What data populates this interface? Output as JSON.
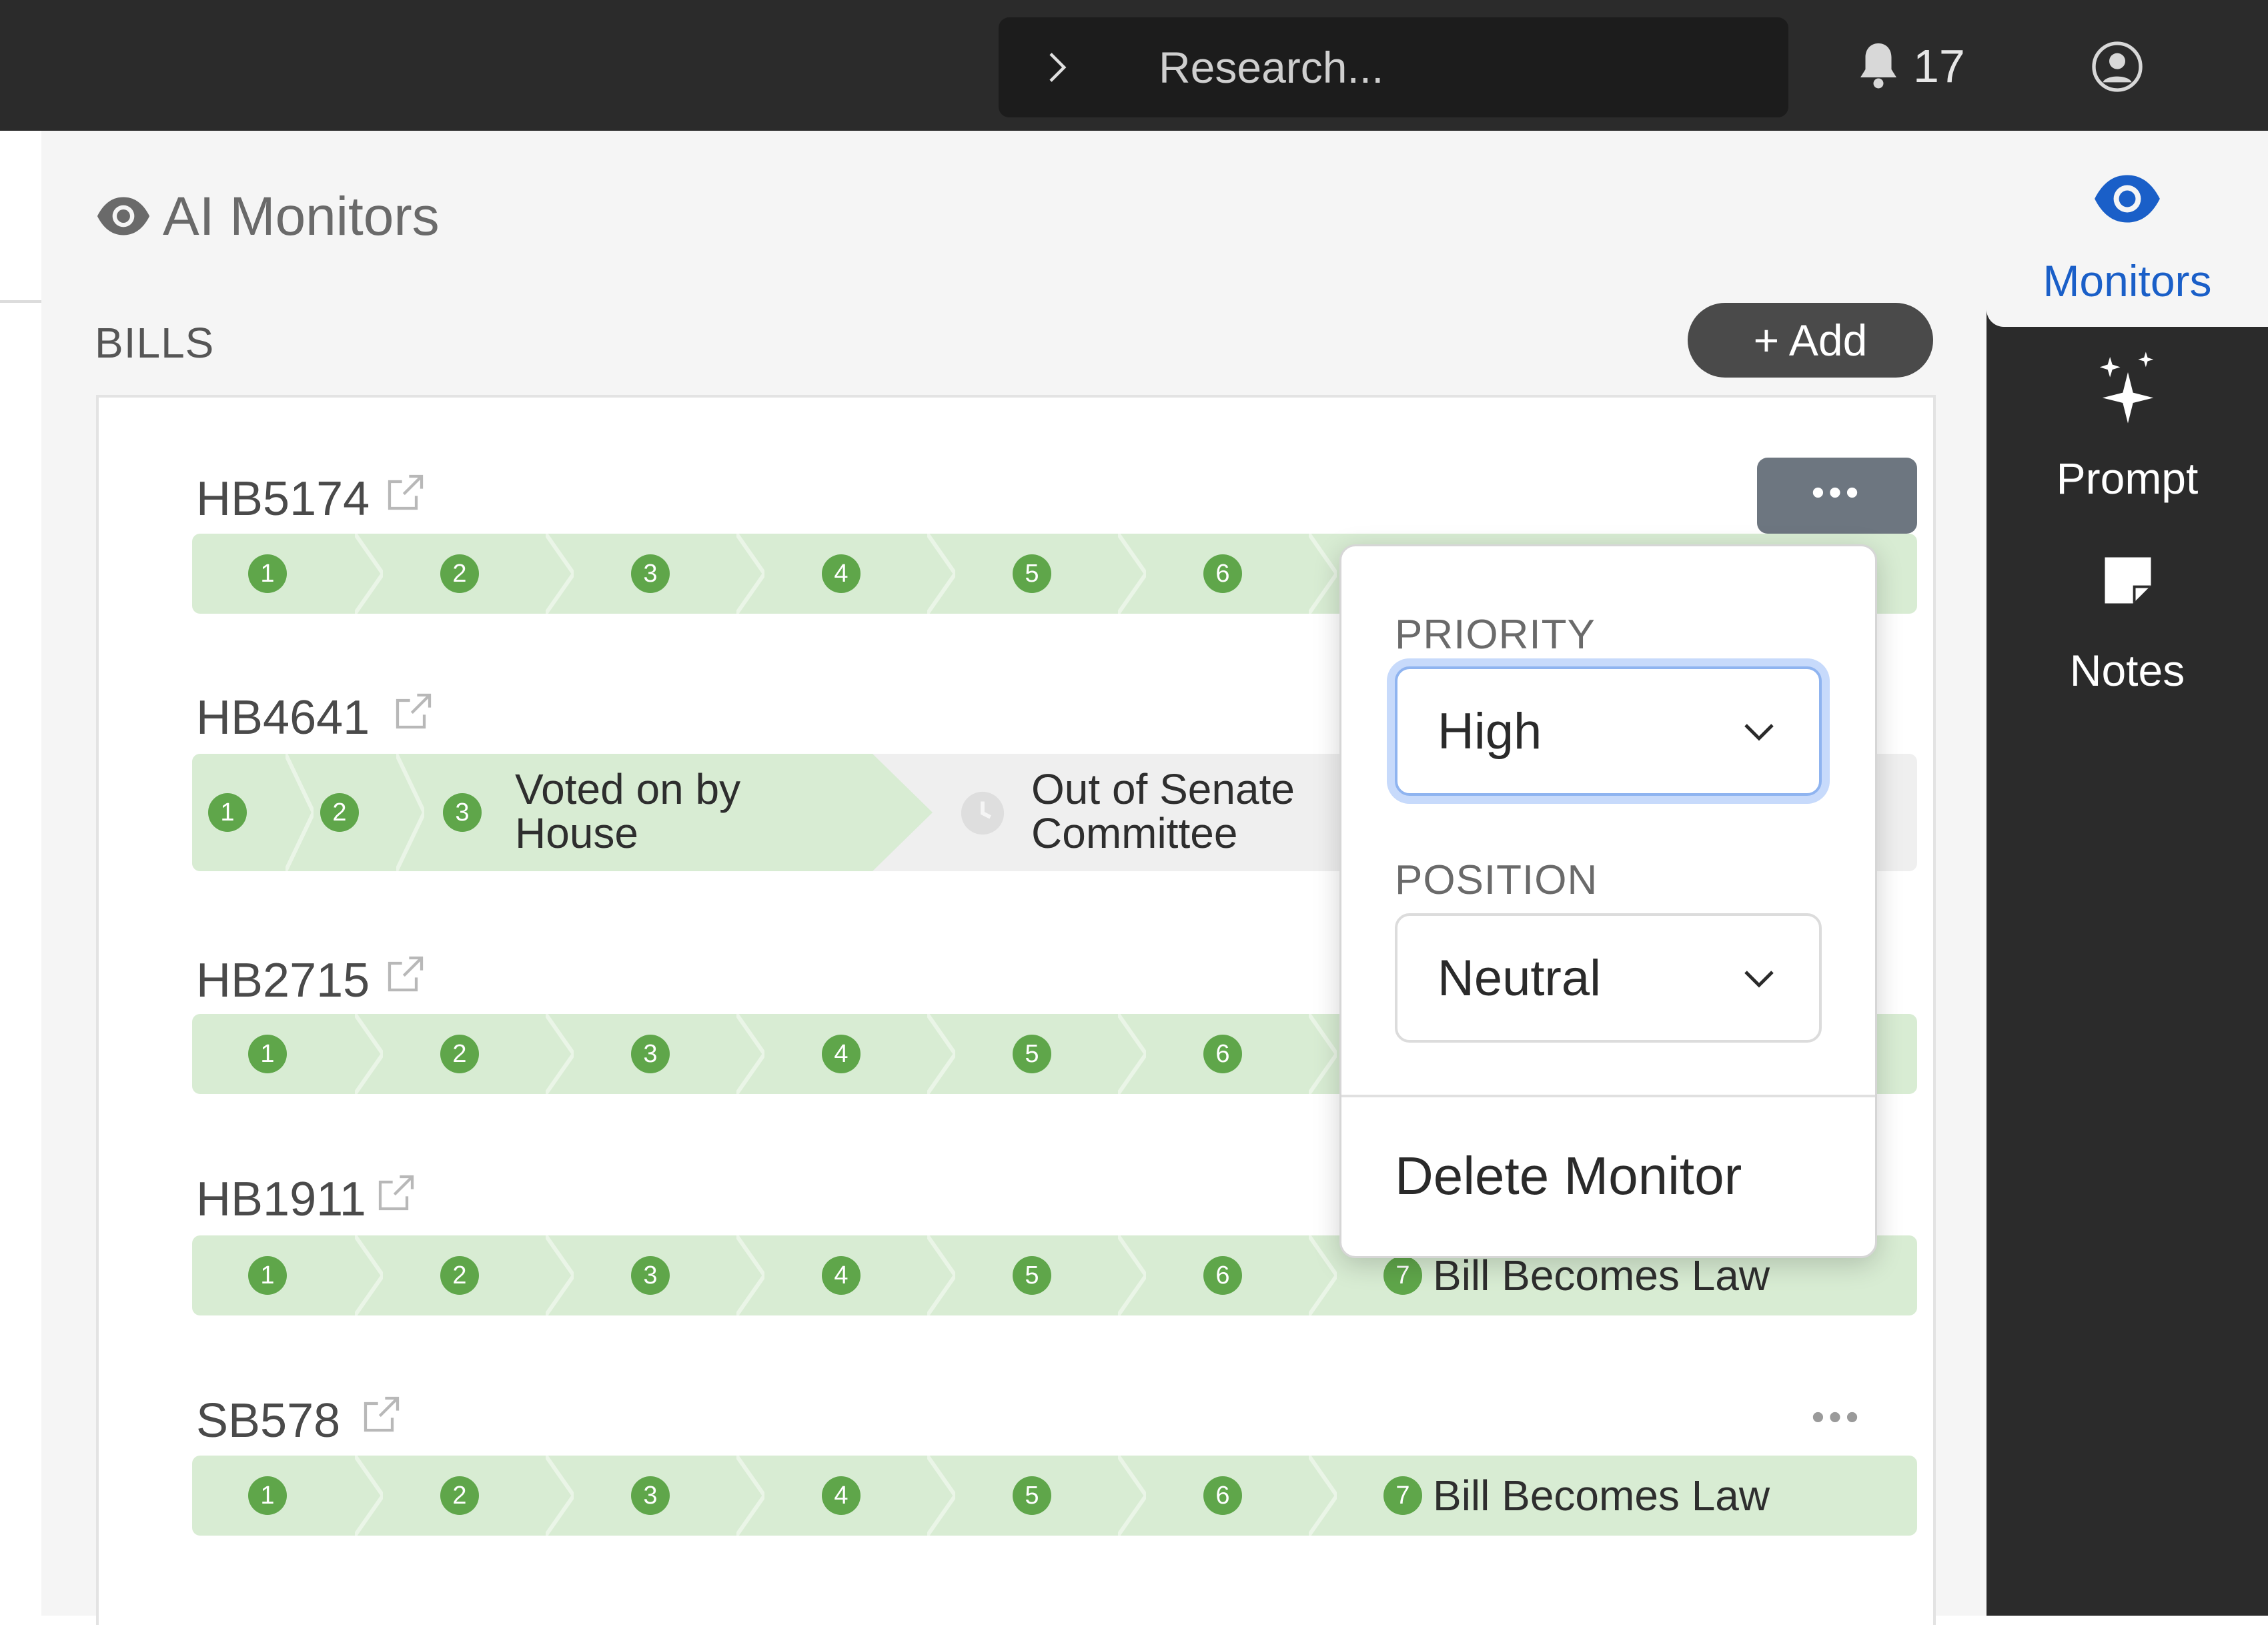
{
  "topbar": {
    "search_placeholder": "Research...",
    "notification_count": "17"
  },
  "page": {
    "title": "AI Monitors",
    "section_label": "BILLS",
    "add_button": "+ Add"
  },
  "bills": [
    {
      "id": "HB5174",
      "steps": [
        "1",
        "2",
        "3",
        "4",
        "5",
        "6"
      ]
    },
    {
      "id": "HB4641",
      "steps": [
        "1",
        "2",
        "3"
      ],
      "current_stage": "Voted on by House",
      "next_stage": "Out of Senate Committee"
    },
    {
      "id": "HB2715",
      "steps": [
        "1",
        "2",
        "3",
        "4",
        "5",
        "6"
      ]
    },
    {
      "id": "HB1911",
      "steps": [
        "1",
        "2",
        "3",
        "4",
        "5",
        "6",
        "7"
      ],
      "final_stage": "Bill Becomes Law"
    },
    {
      "id": "SB578",
      "steps": [
        "1",
        "2",
        "3",
        "4",
        "5",
        "6",
        "7"
      ],
      "final_stage": "Bill Becomes Law"
    }
  ],
  "dropdown": {
    "priority_label": "PRIORITY",
    "priority_value": "High",
    "position_label": "POSITION",
    "position_value": "Neutral",
    "delete_label": "Delete Monitor"
  },
  "sidebar": {
    "items": [
      {
        "label": "Monitors",
        "icon": "eye-icon",
        "active": true
      },
      {
        "label": "Prompt",
        "icon": "sparkle-icon",
        "active": false
      },
      {
        "label": "Notes",
        "icon": "note-icon",
        "active": false
      }
    ]
  },
  "colors": {
    "track_green": "#d8ecd3",
    "step_green": "#5fa64a",
    "accent_blue": "#1a5fc8",
    "dark_bar": "#2b2b2b"
  }
}
